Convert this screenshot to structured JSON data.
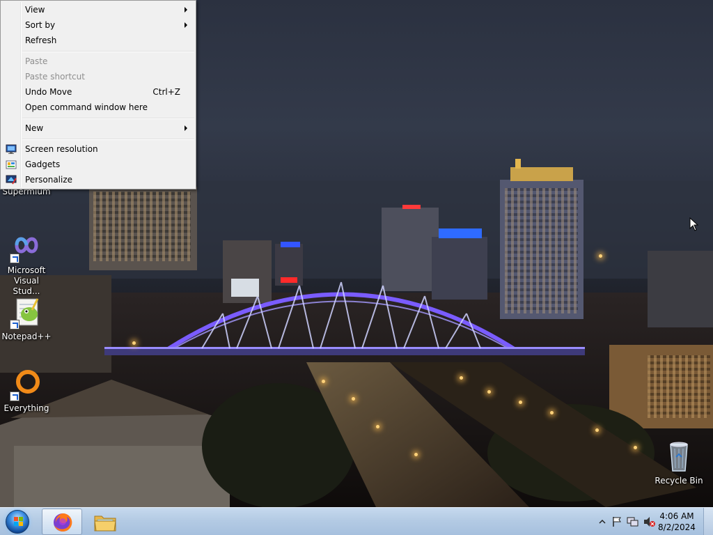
{
  "context_menu": {
    "items": [
      {
        "label": "View",
        "submenu": true
      },
      {
        "label": "Sort by",
        "submenu": true
      },
      {
        "label": "Refresh"
      },
      {
        "label": "Paste",
        "disabled": true
      },
      {
        "label": "Paste shortcut",
        "disabled": true
      },
      {
        "label": "Undo Move",
        "shortcut": "Ctrl+Z"
      },
      {
        "label": "Open command window here"
      },
      {
        "label": "New",
        "submenu": true
      },
      {
        "label": "Screen resolution",
        "icon": "screen-resolution-icon"
      },
      {
        "label": "Gadgets",
        "icon": "gadgets-icon"
      },
      {
        "label": "Personalize",
        "icon": "personalize-icon"
      }
    ]
  },
  "desktop": {
    "icons": [
      {
        "label": "Supermium",
        "icon": "supermium-icon"
      },
      {
        "label": "Microsoft Visual Stud...",
        "icon": "visual-studio-icon"
      },
      {
        "label": "Notepad++",
        "icon": "notepad-plus-plus-icon"
      },
      {
        "label": "Everything",
        "icon": "everything-search-icon"
      },
      {
        "label": "Recycle Bin",
        "icon": "recycle-bin-icon"
      }
    ]
  },
  "taskbar": {
    "pinned": [
      {
        "name": "Firefox",
        "icon": "firefox-icon",
        "active": true
      },
      {
        "name": "Windows Explorer",
        "icon": "folder-icon",
        "active": false
      }
    ],
    "tray_icons": [
      "show-hidden-icons-chevron",
      "action-center-flag-icon",
      "network-icon",
      "volume-muted-icon"
    ],
    "clock": {
      "time": "4:06 AM",
      "date": "8/2/2024"
    }
  },
  "colors": {
    "taskbar": "#b4cbe4",
    "menu_bg": "#f0f0f0",
    "bridge_light": "#7a5cff"
  }
}
